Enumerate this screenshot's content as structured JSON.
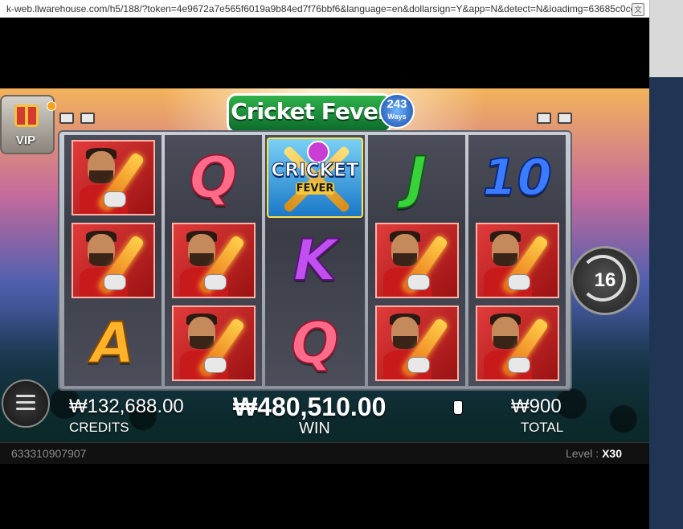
{
  "browser": {
    "url": "k-web.llwarehouse.com/h5/188/?token=4e9672a7e565f6019a9b84ed7f76bbf6&language=en&dollarsign=Y&app=N&detect=N&loadimg=63685c0ce..."
  },
  "game": {
    "title": "Cricket Fever",
    "ways_number": "243",
    "ways_label": "Ways",
    "vip_label": "VIP",
    "free_spins_remaining": "16",
    "wild_symbol": {
      "line1": "CRICKET",
      "line2": "FEVER"
    },
    "reels": [
      [
        "player",
        "player",
        "A"
      ],
      [
        "Q",
        "player",
        "player"
      ],
      [
        "wild",
        "K",
        "Q"
      ],
      [
        "J",
        "player",
        "player"
      ],
      [
        "10",
        "player",
        "player"
      ]
    ]
  },
  "hud": {
    "credits_value": "₩132,688.00",
    "credits_label": "CREDITS",
    "win_value": "₩480,510.00",
    "win_label": "WIN",
    "total_value": "₩900",
    "total_label": "TOTAL"
  },
  "footer": {
    "session_id": "633310907907",
    "level_label": "Level : ",
    "level_value": "X30"
  },
  "colors": {
    "player_bg": "#e23b3b",
    "Q": "#ff6b88",
    "J": "#39d23a",
    "ten": "#3b7cff",
    "K": "#c24ff0",
    "A": "#ffb32a"
  }
}
